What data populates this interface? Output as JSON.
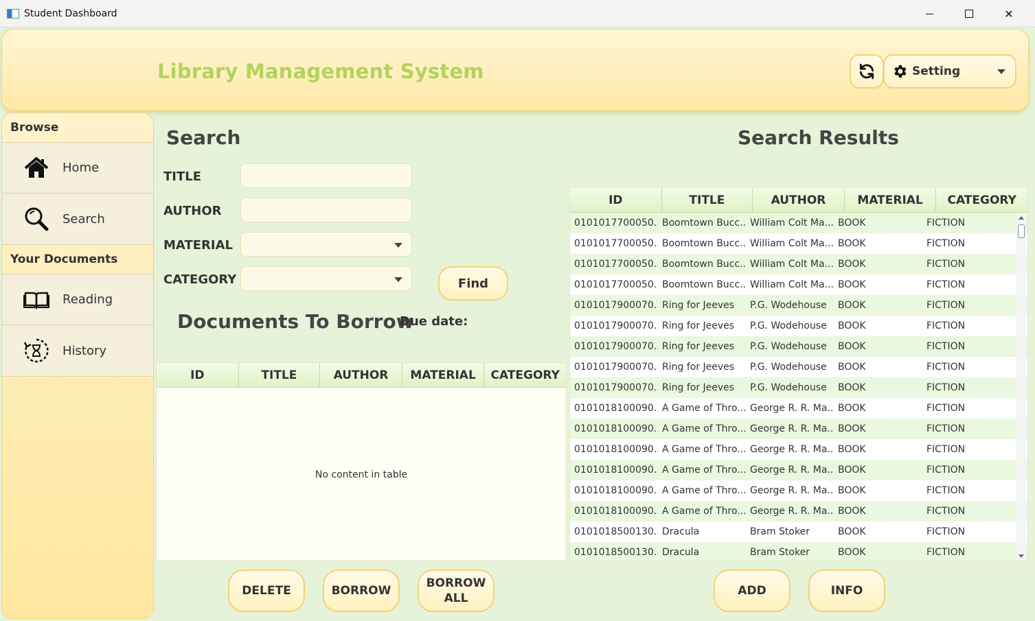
{
  "window": {
    "title": "Student Dashboard"
  },
  "header": {
    "app_title": "Library Management System",
    "setting_label": "Setting"
  },
  "sidebar": {
    "sections": [
      {
        "label": "Browse"
      },
      {
        "label": "Your Documents"
      }
    ],
    "items": [
      {
        "label": "Home",
        "icon": "home-icon"
      },
      {
        "label": "Search",
        "icon": "search-icon"
      },
      {
        "label": "Reading",
        "icon": "book-icon"
      },
      {
        "label": "History",
        "icon": "history-icon"
      }
    ]
  },
  "search": {
    "title": "Search",
    "labels": {
      "title": "TITLE",
      "author": "AUTHOR",
      "material": "MATERIAL",
      "category": "CATEGORY"
    },
    "values": {
      "title": "",
      "author": "",
      "material": "",
      "category": ""
    },
    "find_label": "Find"
  },
  "borrow": {
    "title": "Documents To Borrow",
    "due_label": "Due date:",
    "columns": [
      "ID",
      "TITLE",
      "AUTHOR",
      "MATERIAL",
      "CATEGORY"
    ],
    "empty_message": "No content in table"
  },
  "results": {
    "title": "Search Results",
    "columns": [
      "ID",
      "TITLE",
      "AUTHOR",
      "MATERIAL",
      "CATEGORY"
    ],
    "rows": [
      [
        "0101017700050...",
        "Boomtown Bucc...",
        "William Colt Ma...",
        "BOOK",
        "FICTION"
      ],
      [
        "0101017700050...",
        "Boomtown Bucc...",
        "William Colt Ma...",
        "BOOK",
        "FICTION"
      ],
      [
        "0101017700050...",
        "Boomtown Bucc...",
        "William Colt Ma...",
        "BOOK",
        "FICTION"
      ],
      [
        "0101017700050...",
        "Boomtown Bucc...",
        "William Colt Ma...",
        "BOOK",
        "FICTION"
      ],
      [
        "0101017900070...",
        "Ring for Jeeves",
        "P.G. Wodehouse",
        "BOOK",
        "FICTION"
      ],
      [
        "0101017900070...",
        "Ring for Jeeves",
        "P.G. Wodehouse",
        "BOOK",
        "FICTION"
      ],
      [
        "0101017900070...",
        "Ring for Jeeves",
        "P.G. Wodehouse",
        "BOOK",
        "FICTION"
      ],
      [
        "0101017900070...",
        "Ring for Jeeves",
        "P.G. Wodehouse",
        "BOOK",
        "FICTION"
      ],
      [
        "0101017900070...",
        "Ring for Jeeves",
        "P.G. Wodehouse",
        "BOOK",
        "FICTION"
      ],
      [
        "0101018100090...",
        "A Game of Thro...",
        "George R. R. Ma...",
        "BOOK",
        "FICTION"
      ],
      [
        "0101018100090...",
        "A Game of Thro...",
        "George R. R. Ma...",
        "BOOK",
        "FICTION"
      ],
      [
        "0101018100090...",
        "A Game of Thro...",
        "George R. R. Ma...",
        "BOOK",
        "FICTION"
      ],
      [
        "0101018100090...",
        "A Game of Thro...",
        "George R. R. Ma...",
        "BOOK",
        "FICTION"
      ],
      [
        "0101018100090...",
        "A Game of Thro...",
        "George R. R. Ma...",
        "BOOK",
        "FICTION"
      ],
      [
        "0101018100090...",
        "A Game of Thro...",
        "George R. R. Ma...",
        "BOOK",
        "FICTION"
      ],
      [
        "0101018500130...",
        "Dracula",
        "Bram Stoker",
        "BOOK",
        "FICTION"
      ],
      [
        "0101018500130...",
        "Dracula",
        "Bram Stoker",
        "BOOK",
        "FICTION"
      ]
    ]
  },
  "actions": {
    "delete": "DELETE",
    "borrow": "BORROW",
    "borrow_all_1": "BORROW",
    "borrow_all_2": "ALL",
    "add": "ADD",
    "info": "INFO"
  },
  "colors": {
    "title_green": "#b3d35c",
    "header_yellow": "#ffe9a8",
    "panel_green": "#e6f3d9"
  }
}
